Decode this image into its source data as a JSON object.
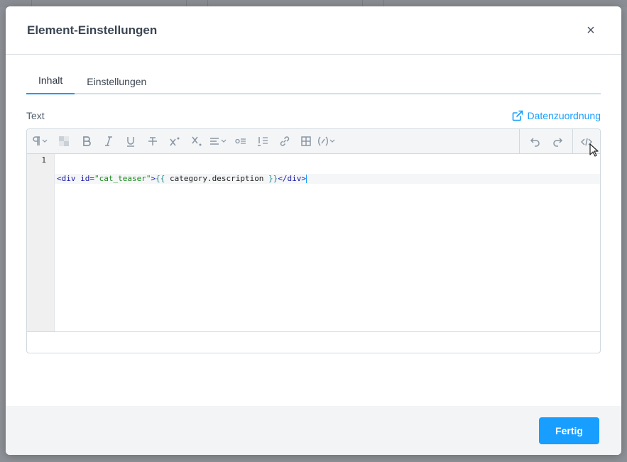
{
  "modal": {
    "title": "Element-Einstellungen",
    "close_label": "×"
  },
  "tabs": [
    {
      "label": "Inhalt",
      "active": true
    },
    {
      "label": "Einstellungen",
      "active": false
    }
  ],
  "field": {
    "label": "Text",
    "mapping_link": "Datenzuordnung"
  },
  "toolbar": {
    "items": [
      "paragraph-format-icon",
      "clear-format-icon",
      "bold-icon",
      "italic-icon",
      "underline-icon",
      "strikethrough-icon",
      "superscript-icon",
      "subscript-icon",
      "align-icon",
      "unordered-list-icon",
      "ordered-list-icon",
      "link-icon",
      "table-icon",
      "variable-icon"
    ],
    "right_items": [
      "undo-icon",
      "redo-icon",
      "code-view-icon"
    ]
  },
  "code": {
    "line_number": "1",
    "tokens": {
      "t1": "<div ",
      "t2": "id=",
      "t3": "\"cat_teaser\"",
      "t4": ">",
      "t5": "{{",
      "t6": " category.description ",
      "t7": "}}",
      "t8": "</div>"
    }
  },
  "footer": {
    "done_label": "Fertig"
  },
  "colors": {
    "accent": "#189eff",
    "overlay": "#8e9197"
  }
}
